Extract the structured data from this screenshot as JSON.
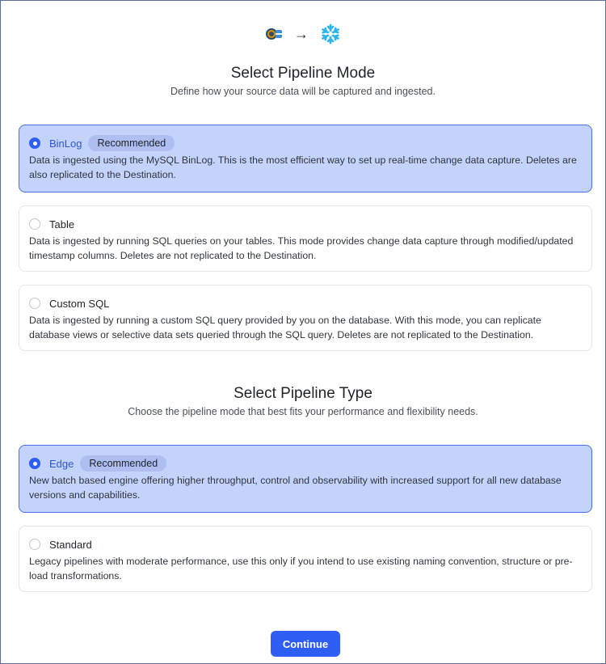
{
  "header": {
    "source_icon": "mysql-source-icon",
    "arrow": "→",
    "destination_icon": "snowflake-icon"
  },
  "mode_section": {
    "title": "Select Pipeline Mode",
    "subtitle": "Define how your source data will be captured and ingested.",
    "options": [
      {
        "label": "BinLog",
        "badge": "Recommended",
        "selected": true,
        "description": "Data is ingested using the MySQL BinLog. This is the most efficient way to set up real-time change data capture. Deletes are also replicated to the Destination."
      },
      {
        "label": "Table",
        "selected": false,
        "description": "Data is ingested by running SQL queries on your tables. This mode provides change data capture through modified/updated timestamp columns. Deletes are not replicated to the Destination."
      },
      {
        "label": "Custom SQL",
        "selected": false,
        "description": "Data is ingested by running a custom SQL query provided by you on the database. With this mode, you can replicate database views or selective data sets queried through the SQL query. Deletes are not replicated to the Destination."
      }
    ]
  },
  "type_section": {
    "title": "Select Pipeline Type",
    "subtitle": "Choose the pipeline mode that best fits your performance and flexibility needs.",
    "options": [
      {
        "label": "Edge",
        "badge": "Recommended",
        "selected": true,
        "description": "New batch based engine offering higher throughput, control and observability with increased support for all new database versions and capabilities."
      },
      {
        "label": "Standard",
        "selected": false,
        "description": "Legacy pipelines with moderate performance, use this only if you intend to use existing naming convention, structure or pre-load transformations."
      }
    ]
  },
  "actions": {
    "continue_label": "Continue"
  },
  "colors": {
    "accent": "#2f5ef5",
    "selected_bg": "#c3d3fb",
    "badge_bg": "#aebef0"
  }
}
